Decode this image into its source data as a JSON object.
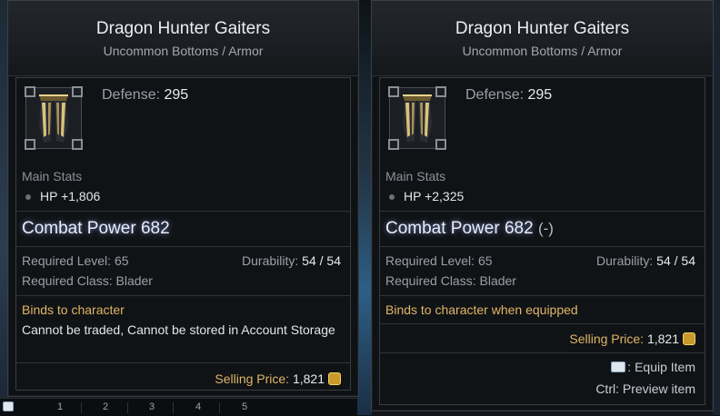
{
  "left_tooltip": {
    "title": "Dragon Hunter Gaiters",
    "subtitle": "Uncommon Bottoms / Armor",
    "defense_label": "Defense:",
    "defense_value": "295",
    "main_stats_label": "Main Stats",
    "main_stat": "HP +1,806",
    "combat_power": "Combat Power 682",
    "required_level_label": "Required Level:",
    "required_level_value": "65",
    "durability_label": "Durability:",
    "durability_value": "54 / 54",
    "required_class_label": "Required Class:",
    "required_class_value": "Blader",
    "bind_text": "Binds to character",
    "trade_note": "Cannot be traded, Cannot be stored in Account Storage",
    "selling_label": "Selling Price:",
    "selling_value": "1,821",
    "icon": "armor-gaiters-icon"
  },
  "right_tooltip": {
    "title": "Dragon Hunter Gaiters",
    "subtitle": "Uncommon Bottoms / Armor",
    "defense_label": "Defense:",
    "defense_value": "295",
    "main_stats_label": "Main Stats",
    "main_stat": "HP +2,325",
    "combat_power": "Combat Power 682",
    "combat_power_diff": "(-)",
    "required_level_label": "Required Level:",
    "required_level_value": "65",
    "durability_label": "Durability:",
    "durability_value": "54 / 54",
    "required_class_label": "Required Class:",
    "required_class_value": "Blader",
    "bind_text": "Binds to character when equipped",
    "selling_label": "Selling Price:",
    "selling_value": "1,821",
    "equip_hint": ": Equip Item",
    "preview_hint": "Ctrl: Preview item",
    "icon": "armor-gaiters-icon"
  },
  "hotbar": {
    "slots": [
      "1",
      "2",
      "3",
      "4",
      "5"
    ]
  },
  "colors": {
    "gold_text": "#e0b565",
    "combat_power_glow": "#aabeff",
    "panel_bg": "#0f1215"
  }
}
